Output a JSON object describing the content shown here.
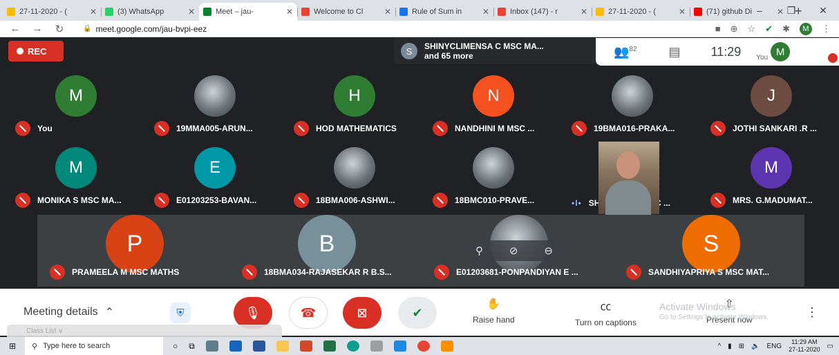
{
  "browser": {
    "tabs": [
      {
        "title": "27-11-2020 - (",
        "color": "#fbbc04"
      },
      {
        "title": "(3) WhatsApp",
        "color": "#25d366"
      },
      {
        "title": "Meet – jau-",
        "color": "#00832d",
        "active": true
      },
      {
        "title": "Welcome to Cl",
        "color": "#ea4335"
      },
      {
        "title": "Rule of Sum in",
        "color": "#1a73e8"
      },
      {
        "title": "Inbox (147) - r",
        "color": "#ea4335"
      },
      {
        "title": "27-11-2020 - (",
        "color": "#fbbc04"
      },
      {
        "title": "(71) github Di",
        "color": "#ff0000"
      }
    ],
    "new_tab": "+",
    "url": "meet.google.com/jau-bvpi-eez",
    "profile_initial": "M"
  },
  "meet": {
    "rec_label": "REC",
    "presenter": {
      "initial": "S",
      "name": "SHINYCLIMENSA C MSC MA...",
      "more": "and 65 more"
    },
    "participant_count": "82",
    "clock": "11:29",
    "you_label": "You",
    "self_initial": "M",
    "participants": [
      {
        "name": "You",
        "initial": "M",
        "color": "#2e7d32"
      },
      {
        "name": "19MMA005-ARUN...",
        "photo": true
      },
      {
        "name": "HOD MATHEMATICS",
        "initial": "H",
        "color": "#2e7d32"
      },
      {
        "name": "NANDHINI M MSC ...",
        "initial": "N",
        "color": "#f4511e"
      },
      {
        "name": "19BMA016-PRAKA...",
        "photo": true
      },
      {
        "name": "JOTHI SANKARI .R ...",
        "initial": "J",
        "color": "#6d4c41"
      },
      {
        "name": "MONIKA S MSC MA...",
        "initial": "M",
        "color": "#00897b"
      },
      {
        "name": "E01203253-BAVAN...",
        "initial": "E",
        "color": "#0097a7"
      },
      {
        "name": "18BMA006-ASHWI...",
        "photo": true
      },
      {
        "name": "18BMC010-PRAVE...",
        "photo": true
      },
      {
        "name": "SHARMILA D MSC ...",
        "video": true
      },
      {
        "name": "MRS. G.MADUMAT...",
        "initial": "M",
        "color": "#5e35b1"
      },
      {
        "name": "PRAMEELA M MSC MATHS",
        "initial": "P",
        "color": "#d84315"
      },
      {
        "name": "18BMA034-RAJASEKAR R B.S...",
        "initial": "B",
        "color": "#78909c"
      },
      {
        "name": "E01203681-PONPANDIYAN E ...",
        "photo": true
      },
      {
        "name": "SANDHIYAPRIYA S MSC MAT...",
        "initial": "S",
        "color": "#ef6c00"
      }
    ]
  },
  "controls": {
    "meeting_details": "Meeting details",
    "raise_hand": "Raise hand",
    "captions": "Turn on captions",
    "present_now": "Present now",
    "watermark_title": "Activate Windows",
    "watermark_sub": "Go to Settings to activate Windows.",
    "class_list": "Class List ∨"
  },
  "taskbar": {
    "search_placeholder": "Type here to search",
    "lang": "ENG",
    "time": "11:29 AM",
    "date": "27-11-2020"
  }
}
